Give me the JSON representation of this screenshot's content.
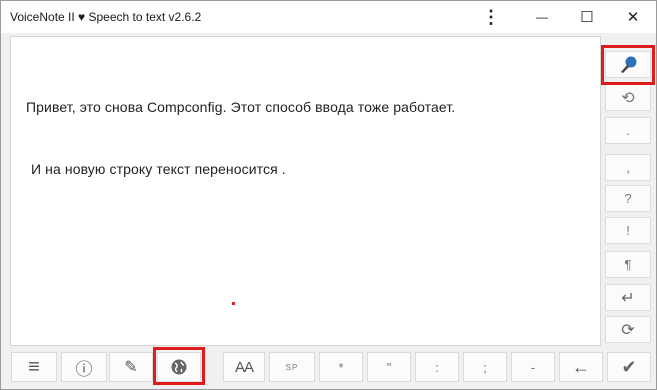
{
  "window": {
    "title": "VoiceNote II ♥ Speech to text v2.6.2",
    "menu_glyph": "⋮",
    "minimize_glyph": "—",
    "maximize_glyph": "☐",
    "close_glyph": "✕"
  },
  "editor": {
    "lines": [
      "Привет, это снова Compconfig. Этот способ ввода тоже работает.",
      "И на новую строку текст переносится ."
    ]
  },
  "sidebar": {
    "buttons": [
      {
        "name": "microphone-button",
        "icon": "microphone-icon",
        "label": ""
      },
      {
        "name": "undo-button",
        "icon": "undo-icon",
        "label": "⟲"
      },
      {
        "name": "period-button",
        "icon": "",
        "label": "."
      },
      {
        "name": "comma-button",
        "icon": "",
        "label": ","
      },
      {
        "name": "question-button",
        "icon": "",
        "label": "?"
      },
      {
        "name": "exclamation-button",
        "icon": "",
        "label": "!"
      },
      {
        "name": "paragraph-button",
        "icon": "",
        "label": "¶"
      },
      {
        "name": "enter-button",
        "icon": "enter-icon",
        "label": "↵"
      },
      {
        "name": "redo-button",
        "icon": "redo-icon",
        "label": "⟳"
      }
    ]
  },
  "toolbar": {
    "buttons": [
      {
        "name": "menu-button",
        "icon": "hamburger-icon",
        "label": "≡"
      },
      {
        "name": "info-button",
        "icon": "info-icon",
        "label": "ⓘ"
      },
      {
        "name": "edit-button",
        "icon": "pencil-icon",
        "label": "✎"
      },
      {
        "name": "language-button",
        "icon": "globe-icon",
        "label": ""
      },
      {
        "name": "font-size-button",
        "icon": "",
        "label": "AA"
      },
      {
        "name": "space-button",
        "icon": "",
        "label": "SP"
      },
      {
        "name": "asterisk-button",
        "icon": "",
        "label": "*"
      },
      {
        "name": "quote-button",
        "icon": "",
        "label": "\""
      },
      {
        "name": "colon-button",
        "icon": "",
        "label": ":"
      },
      {
        "name": "semicolon-button",
        "icon": "",
        "label": ";"
      },
      {
        "name": "dash-button",
        "icon": "",
        "label": "-"
      },
      {
        "name": "backspace-button",
        "icon": "backspace-icon",
        "label": "←"
      },
      {
        "name": "confirm-button",
        "icon": "check-icon",
        "label": "✔"
      }
    ]
  },
  "colors": {
    "highlight": "#e01b1b",
    "mic_fill": "#2f6fb5"
  }
}
